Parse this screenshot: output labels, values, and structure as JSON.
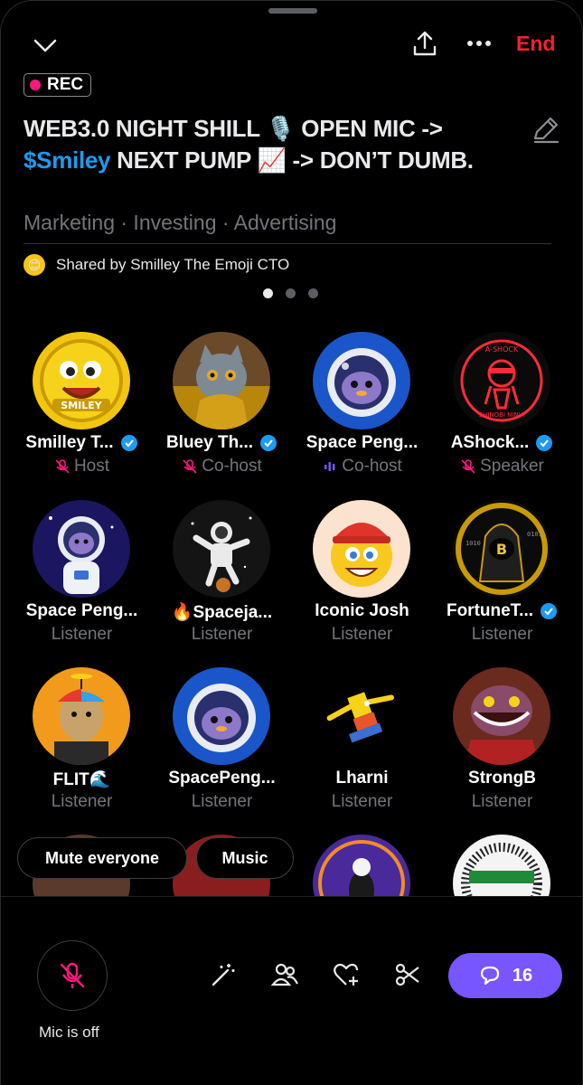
{
  "header": {
    "end_label": "End",
    "rec_label": "REC",
    "title_part1": "WEB3.0 NIGHT SHILL 🎙️ OPEN MIC ->",
    "title_ticker": "$Smiley",
    "title_part2": " NEXT PUMP 📈 -> DON’T DUMB.",
    "topics": "Marketing · Investing · Advertising",
    "shared_by": "Shared by Smilley The Emoji CTO",
    "page_indicator": {
      "pages": 3,
      "active": 1
    }
  },
  "participants": [
    {
      "name": "Smilley T...",
      "role": "Host",
      "role_icon": "mic-off-icon",
      "verified": true,
      "avatar": "smiley-coin"
    },
    {
      "name": "Bluey Th...",
      "role": "Co-host",
      "role_icon": "mic-off-icon",
      "verified": true,
      "avatar": "cat-king"
    },
    {
      "name": "Space Peng...",
      "role": "Co-host",
      "role_icon": "speaking-icon",
      "verified": false,
      "avatar": "space-penguin"
    },
    {
      "name": "AShock...",
      "role": "Speaker",
      "role_icon": "mic-off-icon",
      "verified": true,
      "avatar": "ninja-neon"
    },
    {
      "name": "Space Peng...",
      "role": "Listener",
      "verified": false,
      "avatar": "space-penguin-suit"
    },
    {
      "name": "🔥Spaceja...",
      "role": "Listener",
      "verified": false,
      "avatar": "astronaut"
    },
    {
      "name": "Iconic Josh",
      "role": "Listener",
      "verified": false,
      "avatar": "beanie-smiley"
    },
    {
      "name": "FortuneT...",
      "role": "Listener",
      "verified": true,
      "avatar": "hooded-coin"
    },
    {
      "name": "FLIT🌊",
      "role": "Listener",
      "verified": false,
      "avatar": "ape-propeller"
    },
    {
      "name": "SpacePeng...",
      "role": "Listener",
      "verified": false,
      "avatar": "space-penguin"
    },
    {
      "name": "Lharni",
      "role": "Listener",
      "verified": false,
      "avatar": "bart-flying"
    },
    {
      "name": "StrongB",
      "role": "Listener",
      "verified": false,
      "avatar": "croc-monster"
    }
  ],
  "controls": {
    "mute_everyone": "Mute everyone",
    "music": "Music",
    "mic_label": "Mic is off",
    "reply_count": "16"
  },
  "colors": {
    "accent_red": "#f4212e",
    "verified_blue": "#1d9bf0",
    "mic_pink": "#f91880",
    "speaking_purple": "#7856ff",
    "muted_gray": "#71767b"
  }
}
